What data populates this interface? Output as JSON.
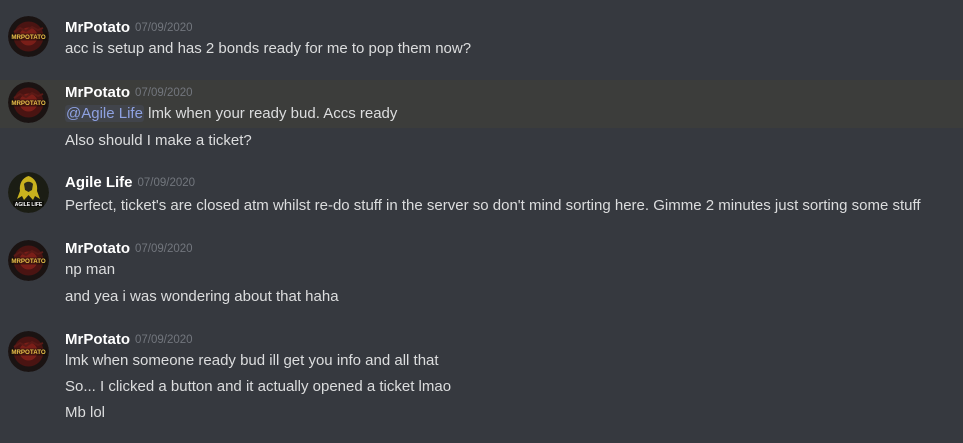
{
  "channel": {
    "messages": [
      {
        "author": "MrPotato",
        "avatar_text": "MRPOTATO",
        "timestamp": "07/09/2020",
        "lines": [
          "acc is setup and has 2 bonds ready for me to pop them now?"
        ]
      },
      {
        "author": "MrPotato",
        "avatar_text": "MRPOTATO",
        "timestamp": "07/09/2020",
        "highlighted": true,
        "mention": "@Agile Life",
        "lines": [
          " lmk when your ready bud. Accs ready",
          "Also should I make a ticket?"
        ]
      },
      {
        "author": "Agile Life",
        "avatar_text": "AGILE LIFE",
        "timestamp": "07/09/2020",
        "lines": [
          "Perfect, ticket's are closed atm whilst re-do stuff in the server so don't mind sorting here. Gimme 2 minutes just sorting some stuff"
        ]
      },
      {
        "author": "MrPotato",
        "avatar_text": "MRPOTATO",
        "timestamp": "07/09/2020",
        "lines": [
          "np man",
          "and yea i was wondering about that haha"
        ]
      },
      {
        "author": "MrPotato",
        "avatar_text": "MRPOTATO",
        "timestamp": "07/09/2020",
        "lines": [
          "lmk when someone ready bud ill get you info and all that",
          "So... I clicked a button and it actually opened a ticket lmao",
          "Mb lol"
        ]
      }
    ]
  },
  "colors": {
    "background": "#36393f",
    "highlight_row": "#3c3d3b",
    "username": "#ffffff",
    "timestamp": "#72767d",
    "message_text": "#dcddde",
    "mention": "#8ea1e1"
  }
}
